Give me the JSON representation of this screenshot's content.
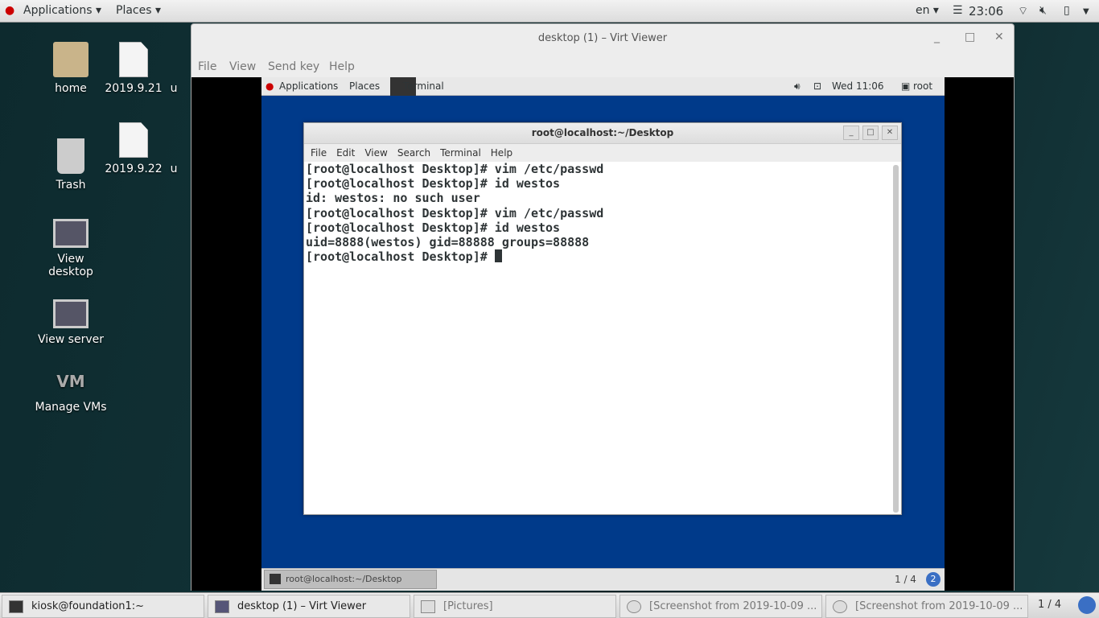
{
  "topbar": {
    "applications": "Applications ▾",
    "places": "Places ▾",
    "lang": "en ▾",
    "time": "23:06",
    "icons": [
      "wifi-icon",
      "volume-muted-icon",
      "battery-icon",
      "chevron-down-icon"
    ]
  },
  "desktop": [
    {
      "label": "home",
      "icon": "home-folder-icon"
    },
    {
      "label": "2019.9.21",
      "icon": "document-icon"
    },
    {
      "label": "Trash",
      "icon": "trash-icon"
    },
    {
      "label": "2019.9.22",
      "icon": "document-icon"
    },
    {
      "label": "View desktop",
      "icon": "monitor-icon"
    },
    {
      "label": "View server",
      "icon": "monitor-icon"
    },
    {
      "label": "Manage VMs",
      "icon": "vm-logo-icon"
    },
    {
      "label": "u"
    },
    {
      "label": "u"
    }
  ],
  "virtviewer": {
    "title": "desktop (1) – Virt Viewer",
    "menu": [
      "File",
      "View",
      "Send key",
      "Help"
    ]
  },
  "guest": {
    "applications": "Applications",
    "places": "Places",
    "terminal": "Terminal",
    "clock": "Wed 11:06",
    "user": "root",
    "taskitem": "root@localhost:~/Desktop",
    "workspace": "1 / 4",
    "badge": "2"
  },
  "terminal": {
    "title": "root@localhost:~/Desktop",
    "menu": [
      "File",
      "Edit",
      "View",
      "Search",
      "Terminal",
      "Help"
    ],
    "lines": [
      "[root@localhost Desktop]# vim /etc/passwd",
      "[root@localhost Desktop]# id westos",
      "id: westos: no such user",
      "[root@localhost Desktop]# vim /etc/passwd",
      "[root@localhost Desktop]# id westos",
      "uid=8888(westos) gid=88888 groups=88888"
    ],
    "prompt": "[root@localhost Desktop]# "
  },
  "taskbar": {
    "items": [
      "kiosk@foundation1:~",
      "desktop (1) – Virt Viewer",
      "[Pictures]",
      "[Screenshot from 2019-10-09 ...",
      "[Screenshot from 2019-10-09 ..."
    ],
    "workspace": "1 / 4"
  }
}
